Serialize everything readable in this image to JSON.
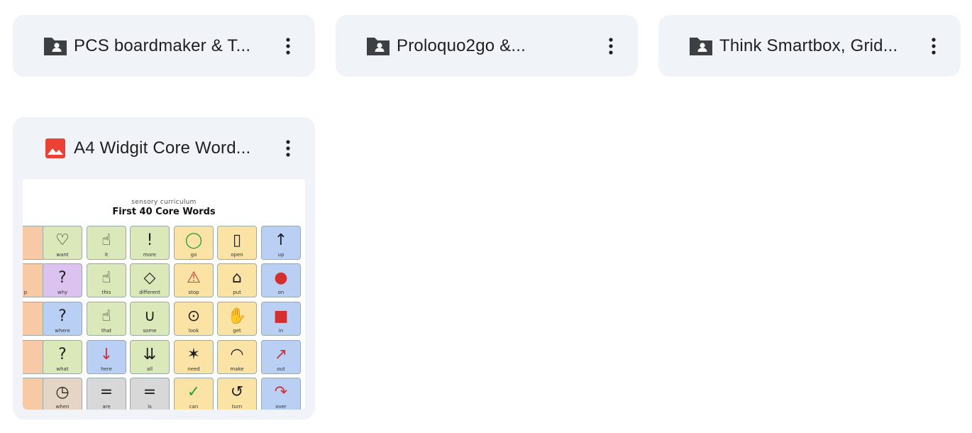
{
  "folders": [
    {
      "title": "PCS boardmaker & T...",
      "icon": "shared-folder-icon"
    },
    {
      "title": "Proloquo2go &...",
      "icon": "shared-folder-icon"
    },
    {
      "title": "Think Smartbox, Grid...",
      "icon": "shared-folder-icon"
    }
  ],
  "file": {
    "title": "A4 Widgit Core Word...",
    "icon": "image-file-icon",
    "preview": {
      "brand": "sensory curriculum",
      "heading": "First 40 Core Words",
      "words": [
        [
          "",
          "want",
          "it",
          "more",
          "go",
          "open",
          "up"
        ],
        [
          "p",
          "why",
          "this",
          "different",
          "stop",
          "put",
          "on"
        ],
        [
          "",
          "where",
          "that",
          "some",
          "look",
          "get",
          "in"
        ],
        [
          "",
          "what",
          "here",
          "all",
          "need",
          "make",
          "out"
        ],
        [
          "",
          "when",
          "are",
          "is",
          "can",
          "turn",
          "over"
        ]
      ]
    }
  },
  "colors": {
    "card_bg": "#f0f4f9",
    "icon_dark": "#3c4043",
    "image_icon_red": "#ea4335"
  }
}
